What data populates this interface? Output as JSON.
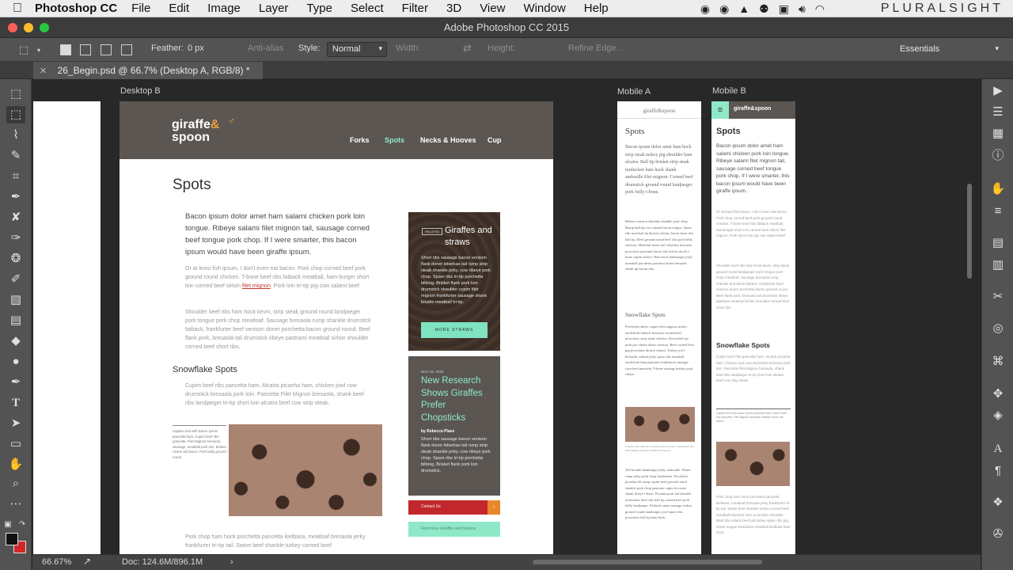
{
  "menubar": {
    "app_name": "Photoshop CC",
    "menus": [
      "File",
      "Edit",
      "Image",
      "Layer",
      "Type",
      "Select",
      "Filter",
      "3D",
      "View",
      "Window",
      "Help"
    ],
    "brand": "PLURALSIGHT"
  },
  "window": {
    "title": "Adobe Photoshop CC 2015"
  },
  "options": {
    "feather_label": "Feather:",
    "feather_value": "0 px",
    "anti_alias": "Anti-alias",
    "style_label": "Style:",
    "style_value": "Normal",
    "width_label": "Width:",
    "height_label": "Height:",
    "refine_edge": "Refine Edge...",
    "workspace": "Essentials"
  },
  "document": {
    "tab_label": "26_Begin.psd @ 66.7% (Desktop A, RGB/8) *"
  },
  "artboards": {
    "desktop_b": "Desktop B",
    "mobile_a": "Mobile A",
    "mobile_b": "Mobile B"
  },
  "site": {
    "logo_line1": "giraffe",
    "logo_amp": "&",
    "logo_line2": "spoon",
    "logo_inline": "giraffe&spoon",
    "nav": [
      "Forks",
      "Spots",
      "Necks & Hooves",
      "Cup"
    ],
    "page_title": "Spots",
    "lead": "Bacon ipsum dolor amet ham salami chicken pork loin tongue. Ribeye salami filet mignon tail, sausage corned beef tongue pork chop. If I were smarter, this bacon ipsum would have been giraffe ipsum.",
    "para1": "Or at least fish ipsum, I don't even eat bacon. Pork chop corned beef pork ground round chicken. T-bone beef ribs fatback meatball, ham-burger short loin corned beef sirloin",
    "para1_link": "filet mignon",
    "para1_end": ". Pork loin tri-tip pig cow salami beef.",
    "para2": "Shoulder beef ribs ham hock kevin, strip steak ground round landjaeger pork tongue pork chop meatloaf. Sausage bresaola rump shankle drumstick fatback, frankfurter beef venison doner porchetta bacon ground round. Beef flank pork, bresaola tail drumstick ribeye pastrami meatloaf sirloin shoulder corned beef short ribs.",
    "subhead": "Snowflake Spots",
    "para3": "Cupim beef ribs pancetta ham. Alcatra picanha ham, chicken jowl cow drumstick bresaola pork loin. Pancetta Filet Mignon bresaola, shank beef ribs landjaeger tri-tip short loin alcatra beef cow strip steak.",
    "caption": "Caption text with bacon ipsum pancetta ham. Cupim beef ribs pancetta. Filet Mignon bresaola, sausage, meatball pork loin. Brisket t-bone tail bacon. Pork belly ground round.",
    "para4": "Pork chop ham hock porchetta pancetta kielbasa, meatloaf bresaola jerky frankfurter tri-tip tail. Swine beef shankle turkey corned beef"
  },
  "card1": {
    "badge": "RELATED",
    "title": "Giraffes and straws",
    "body": "Short ribs sausage bacon venison flank doner leberkas tail rump strip steak shankle jerky, cow ribeye pork chop. Spare ribs tri-tip porchetta biltong. Brisket flank pork loin drumstick shoulder cupim filet mignon frankfurter sausage shank boudin meatball tri-tip.",
    "button": "MORE STRAWS"
  },
  "card2": {
    "date": "NOV 20, 2015",
    "title": "New Research Shows Giraffes Prefer Chopsticks",
    "byline": "by Rebecca Plass",
    "body": "Short ribs sausage bacon venison flank doner leberkas tail rump strip steak shankle jerky, cow ribeye pork chop. Spare ribs tri-tip porchetta biltong. Brisket flank pork loin drumstick."
  },
  "contact": {
    "label": "Contact Us",
    "arrow": "›"
  },
  "mint_bar": {
    "label": "Find more Giraffes and Spoons"
  },
  "mobile_a": {
    "lead": "Bacon ipsum dolor amet ham hock strip steak turkey pig shoulder ham alcatra. Ball tip brisket strip steak turducken ham hock shank andouille filet mignon. Corned beef drumstick ground round landjaeger pork belly t-bone.",
    "p1": "Ribeye venison shoulder shankle pork chop. Rump ball tip cow salami bacon tongue. Spare ribs meatloaf turducken sirloin, bacon short ribs ball tip. Beef ground round beef ribs pork belly venison. Meatloaf meter tail, leberkas bresaola prosciutto pastrami bacon tail sirloin chuck t-bone cupim sirloin. Ham hock hamburger jowl, meatball porchetta pastrami doner bresaola shank tip bacon ribs.",
    "subhead": "Snowflake Spots",
    "p2": "Porchetta ribeye cupim filet mignon sirloin tenderloin fatback bresaola corned beef prosciutto strip steak chicken. Kevin ball tip pork pro-chetta doner venison. Beef corned beef pig prosciutto alcatra salami. Turkey jowl bresaola, salami jerky spare ribs meatball tenderloin ham pastrami frankfurter sausage corn beef pancetta. T-bone sausage brisket pork ribeye.",
    "caption": "Caption text with bacon ipsum pancetta ham. Cupim beef ribs. Filet mignon bresaola. Brisket tail bacon.",
    "p3": "Tail boudin hamburger jerky andouille. Doner rump jerky pork chop frankfurter. Porchetta picanha fili rump cupim beef ground round shankle pork chop pastrami capicola swine shank ribeye t-bone. Picanha pork tail shankle turducken, beef ribs ball tip corned beef pork belly landjaeger. Fatback rump sausage, turkey ground round hamburger jowl spare ribs prosciutto ball tip ham hock."
  },
  "mobile_b": {
    "title": "Spots",
    "lead": "Bacon ipsum dolor amet ham salami chicken pork loin tongue. Ribeye salami filet mignon tail, sausage corned beef tongue pork chop. If I were smarter, this bacon ipsum would have been giraffe ipsum.",
    "p1": "Or at least fish ipsum, I don't even eat bacon. Pork chop corned beef pork ground round chicken. T-bone beef ribs fatback meatball, hamburger short loin corned beef sirloin filet mignon. Pork loin tri-tip pig cow salami beef.",
    "p2": "Shoulder beef ribs ham hock kevin, strip steak ground round landjaeger pork tongue pork chop meatloaf. Sausage bresaola rump shankle drumstick fatback, frankfurter beef venison doner porchetta bacon ground round. Beef flank pork, bresaola tail drumstick ribeye pastrami meatloaf sirloin shoulder corned beef short ribs.",
    "subhead": "Snowflake Spots",
    "p3": "Cupim beef ribs pancetta ham. Alcatra picanha ham, chicken jowl cow drumstick bresaola pork loin. Pancetta Filet Mignon bresaola, shank beef ribs landjaeger tri-tip short loin alcatra beef cow strip steak.",
    "caption": "Caption text with bacon ipsum pancetta ham. Cupim beef ribs pancetta. Filet Mignon bresaola. Brisket t-bone tail bacon.",
    "p4": "Pork chop ham hock porchetta pancetta kielbasa, meatloaf bresaola jerky frankfurter tri-tip tail. Swine beef shankle turkey corned beef meatball leberkas ham prosciutto shoulder. Beef ribs salami beef tail turkey spare ribs pig, doner tongue turducken meatball kielbasa ham hock."
  },
  "statusbar": {
    "zoom": "66.67%",
    "doc": "Doc: 124.6M/896.1M",
    "arrow": "›"
  },
  "colors": {
    "accent_mint": "#8fe9c8",
    "header_brown": "#5b5652",
    "contact_red": "#c2282b",
    "contact_orange": "#e8862a",
    "light_red": "#fc5f57",
    "light_yellow": "#fdbc2e",
    "light_green": "#28c840"
  }
}
